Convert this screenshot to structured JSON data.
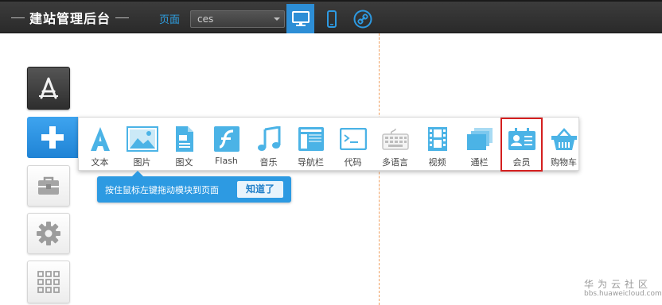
{
  "header": {
    "title": "建站管理后台",
    "page_label": "页面",
    "page_select_value": "ces",
    "device_buttons": [
      {
        "name": "desktop",
        "icon": "monitor-icon",
        "active": true
      },
      {
        "name": "mobile",
        "icon": "phone-icon",
        "active": false
      },
      {
        "name": "link",
        "icon": "link-circle-icon",
        "active": false
      }
    ]
  },
  "sidebar": {
    "tools": [
      {
        "icon": "app-store-icon"
      },
      {
        "icon": "plus-icon",
        "active": true
      },
      {
        "icon": "toolbox-icon"
      },
      {
        "icon": "gear-icon"
      },
      {
        "icon": "grid-apps-icon"
      }
    ]
  },
  "modules": {
    "items": [
      {
        "label": "文本",
        "icon": "text-icon"
      },
      {
        "label": "图片",
        "icon": "image-icon"
      },
      {
        "label": "图文",
        "icon": "image-text-icon"
      },
      {
        "label": "Flash",
        "icon": "flash-icon"
      },
      {
        "label": "音乐",
        "icon": "music-icon"
      },
      {
        "label": "导航栏",
        "icon": "navbar-icon"
      },
      {
        "label": "代码",
        "icon": "code-icon"
      },
      {
        "label": "多语言",
        "icon": "keyboard-icon"
      },
      {
        "label": "视频",
        "icon": "video-icon"
      },
      {
        "label": "通栏",
        "icon": "banner-icon"
      },
      {
        "label": "会员",
        "icon": "member-card-icon",
        "highlighted": true
      },
      {
        "label": "购物车",
        "icon": "cart-icon"
      }
    ]
  },
  "tooltip": {
    "message": "按住鼠标左键拖动模块到页面",
    "confirm_label": "知道了"
  },
  "watermark": {
    "brand": "华为云社区",
    "url": "bbs.huaweicloud.com"
  },
  "colors": {
    "accent": "#2d8ed6",
    "icon_blue": "#4bb3e6",
    "highlight": "#d41f1f"
  }
}
